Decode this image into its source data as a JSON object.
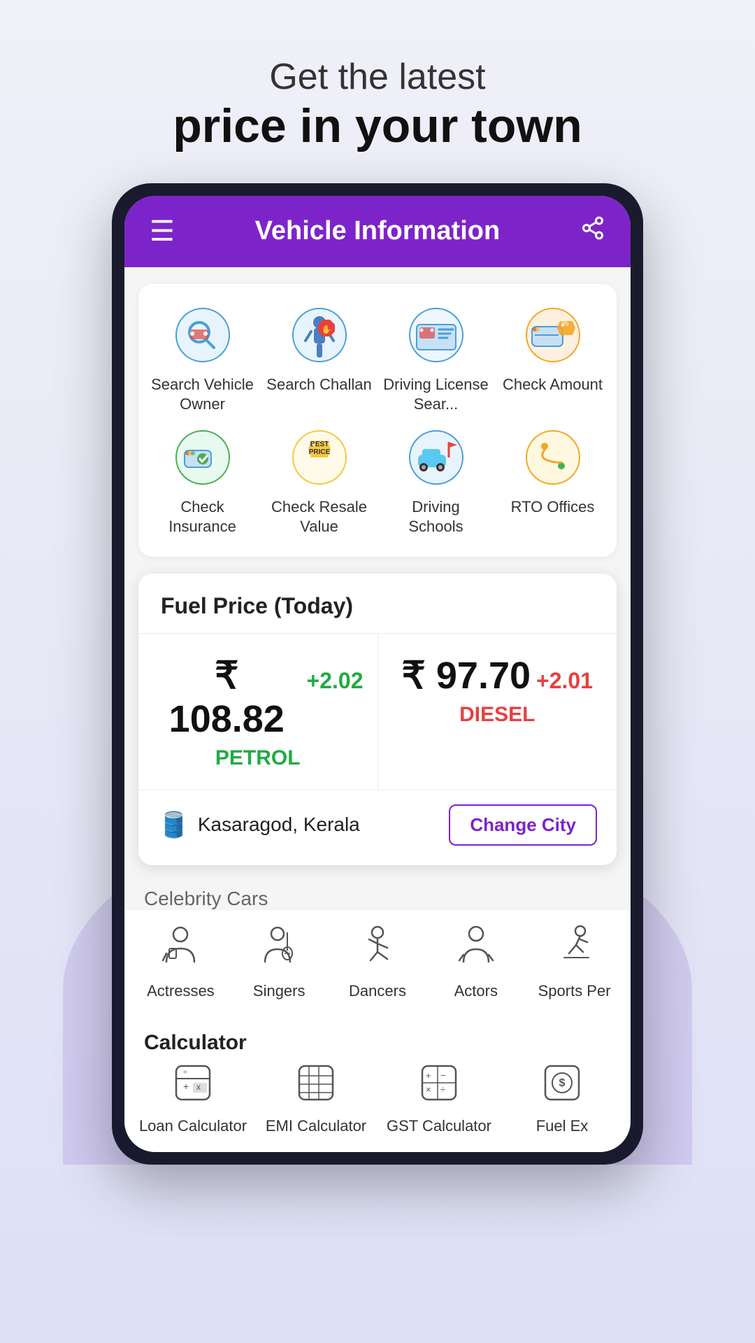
{
  "hero": {
    "subtitle": "Get the latest",
    "title": "price in your town"
  },
  "appBar": {
    "title": "Vehicle Information"
  },
  "vehicleGrid": {
    "row1": [
      {
        "id": "search-vehicle-owner",
        "label": "Search Vehicle Owner",
        "icon": "🔍🚗",
        "emoji": "🔍"
      },
      {
        "id": "search-challan",
        "label": "Search Challan",
        "icon": "👮",
        "emoji": "👮"
      },
      {
        "id": "driving-license",
        "label": "Driving License Sear...",
        "icon": "🚗📋",
        "emoji": "🪪"
      },
      {
        "id": "check-amount",
        "label": "Check Amount",
        "icon": "💰🚗",
        "emoji": "🏷️"
      }
    ],
    "row2": [
      {
        "id": "check-insurance",
        "label": "Check Insurance",
        "icon": "✅🚗",
        "emoji": "✅"
      },
      {
        "id": "check-resale",
        "label": "Check Resale Value",
        "icon": "🏷️",
        "emoji": "🏷️"
      },
      {
        "id": "driving-schools",
        "label": "Driving Schools",
        "icon": "🚗🏫",
        "emoji": "🚙"
      },
      {
        "id": "rto-offices",
        "label": "RTO Offices",
        "icon": "🗺️",
        "emoji": "🗺️"
      }
    ]
  },
  "fuel": {
    "title": "Fuel Price (Today)",
    "petrol": {
      "price": "₹ 108.82",
      "change": "+2.02",
      "label": "PETROL"
    },
    "diesel": {
      "price": "₹ 97.70",
      "change": "+2.01",
      "label": "DIESEL"
    },
    "location": "Kasaragod, Kerala",
    "changeCityLabel": "Change City"
  },
  "celebrity": {
    "sectionLabel": "Celebrity Cars",
    "items": [
      {
        "id": "actresses",
        "label": "Actresses",
        "emoji": "👩‍🎤"
      },
      {
        "id": "singers",
        "label": "Singers",
        "emoji": "🎸"
      },
      {
        "id": "dancers",
        "label": "Dancers",
        "emoji": "💃"
      },
      {
        "id": "actors",
        "label": "Actors",
        "emoji": "🎭"
      },
      {
        "id": "sports-persons",
        "label": "Sports Per",
        "emoji": "⛷️"
      }
    ]
  },
  "calculator": {
    "title": "Calculator",
    "items": [
      {
        "id": "loan-calculator",
        "label": "Loan Calculator",
        "emoji": "🧮"
      },
      {
        "id": "emi-calculator",
        "label": "EMI Calculator",
        "emoji": "📊"
      },
      {
        "id": "gst-calculator",
        "label": "GST Calculator",
        "emoji": "🔣"
      },
      {
        "id": "fuel-ex",
        "label": "Fuel Ex",
        "emoji": "💵"
      }
    ]
  }
}
